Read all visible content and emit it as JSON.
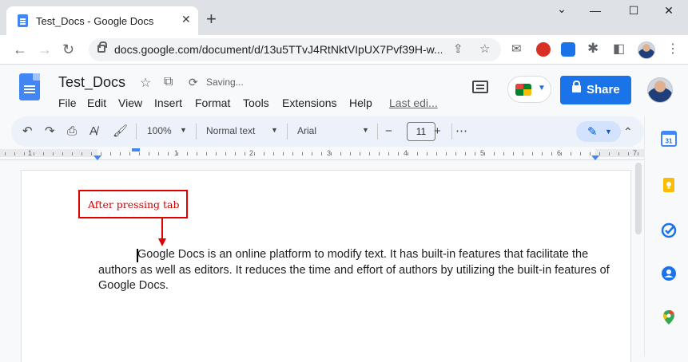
{
  "browser": {
    "tab_title": "Test_Docs - Google Docs",
    "tab_close": "✕",
    "new_tab": "+",
    "win_minimize": "—",
    "win_maximize": "☐",
    "win_close": "✕",
    "url": "docs.google.com/document/d/13u5TTvJ4RtNktVIpUX7Pvf39H-w..."
  },
  "docs": {
    "title": "Test_Docs",
    "saving": "Saving...",
    "menu": [
      "File",
      "Edit",
      "View",
      "Insert",
      "Format",
      "Tools",
      "Extensions",
      "Help"
    ],
    "last_edit": "Last edi...",
    "share_label": "Share"
  },
  "toolbar": {
    "zoom": "100%",
    "style": "Normal text",
    "font": "Arial",
    "font_size": "11",
    "minus": "−",
    "plus": "+",
    "more": "⋯"
  },
  "ruler": {
    "numbers": [
      "1",
      "1",
      "2",
      "3",
      "4",
      "5",
      "6",
      "7"
    ]
  },
  "document": {
    "annotation": "After pressing tab",
    "paragraph": "Google Docs is an online platform to modify text. It has built-in features that facilitate the authors as well as editors. It reduces the time and effort of authors by utilizing the built-in features of Google Docs."
  },
  "colors": {
    "accent": "#1a73e8",
    "annotation_red": "#e00000"
  },
  "side_panel_icons": [
    "calendar-icon",
    "keep-icon",
    "tasks-icon",
    "contacts-icon",
    "maps-icon"
  ]
}
